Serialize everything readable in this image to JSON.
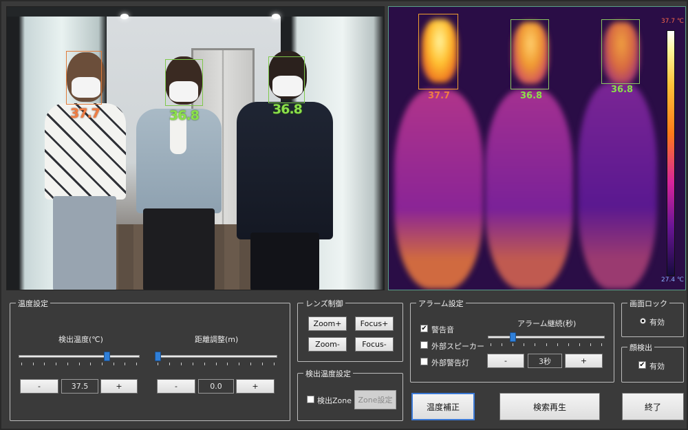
{
  "visible_view": {
    "people": [
      {
        "temp": "37.7",
        "status": "alarm"
      },
      {
        "temp": "36.8",
        "status": "ok"
      },
      {
        "temp": "36.8",
        "status": "ok"
      }
    ]
  },
  "thermal_view": {
    "scale_max": "37.7 ℃",
    "scale_min": "27.4 ℃",
    "people": [
      {
        "temp": "37.7",
        "status": "alarm"
      },
      {
        "temp": "36.8",
        "status": "ok"
      },
      {
        "temp": "36.8",
        "status": "ok"
      }
    ],
    "colors": {
      "alarm": "#f07d43",
      "ok": "#8be04a"
    }
  },
  "temperature_settings": {
    "title": "温度設定",
    "detect_temp_label": "検出温度(℃)",
    "distance_label": "距離調整(m)",
    "detect_temp_value": "37.5",
    "distance_value": "0.0",
    "minus": "-",
    "plus": "+",
    "detect_temp_slider_level": 0.74,
    "distance_slider_level": 0.0
  },
  "lens_control": {
    "title": "レンズ制御",
    "zoom_plus": "Zoom+",
    "focus_plus": "Focus+",
    "zoom_minus": "Zoom-",
    "focus_minus": "Focus-"
  },
  "detect_temp_settings": {
    "title": "検出温度設定",
    "zone_checkbox_label": "検出Zone",
    "zone_checked": false,
    "zone_settings_button": "Zone設定"
  },
  "alarm_settings": {
    "title": "アラーム設定",
    "warning_sound": "警告音",
    "warning_sound_checked": true,
    "external_speaker": "外部スピーカー",
    "external_speaker_checked": false,
    "external_warning_light": "外部警告灯",
    "external_warning_light_checked": false,
    "duration_label": "アラーム継続(秒)",
    "duration_value": "3秒",
    "minus": "-",
    "plus": "+",
    "duration_slider_level": 0.2
  },
  "screen_lock": {
    "title": "画面ロック",
    "option": "有効",
    "selected": true
  },
  "face_detection": {
    "title": "顔検出",
    "option": "有効",
    "checked": true
  },
  "buttons": {
    "temp_correction": "温度補正",
    "search_playback": "検索再生",
    "exit": "終了"
  }
}
